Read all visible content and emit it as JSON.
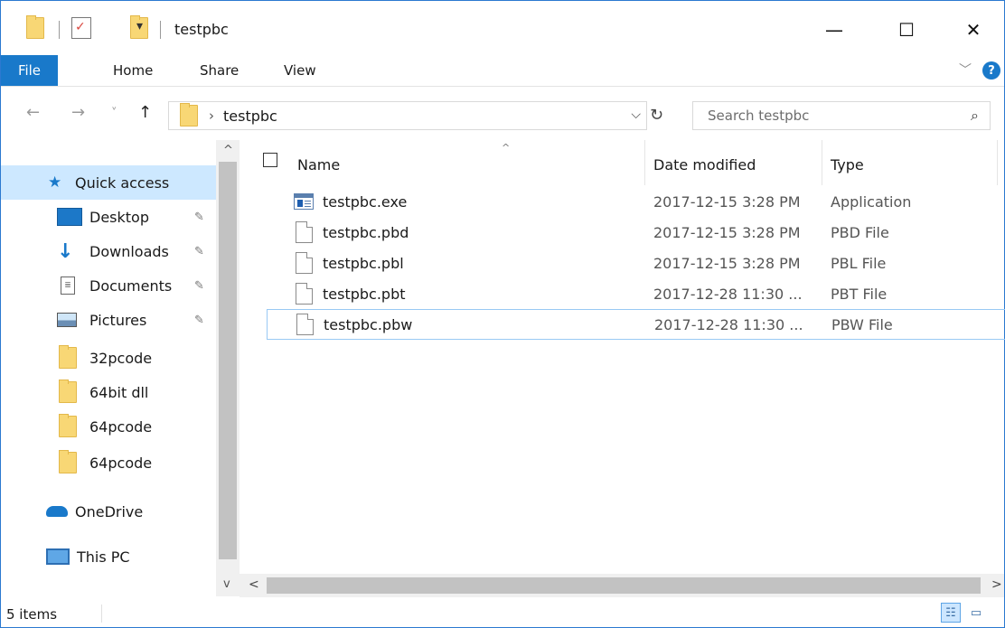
{
  "window": {
    "title": "testpbc",
    "controls": {
      "minimize": "—",
      "maximize": "☐",
      "close": "✕"
    }
  },
  "ribbon": {
    "tabs": [
      "File",
      "Home",
      "Share",
      "View"
    ],
    "help": "?",
    "collapse": "﹀"
  },
  "navigation": {
    "back": "←",
    "forward": "→",
    "recent": "˅",
    "up": "↑",
    "breadcrumb": [
      "testpbc"
    ],
    "breadcrumb_sep": "›",
    "dropdown": "⌵",
    "refresh": "↻"
  },
  "search": {
    "placeholder": "Search testpbc",
    "icon": "⌕"
  },
  "nav_pane": {
    "items": [
      {
        "label": "Quick access",
        "icon": "star-icon",
        "selected": true
      },
      {
        "label": "Desktop",
        "icon": "desktop-icon",
        "pinned": true
      },
      {
        "label": "Downloads",
        "icon": "download-arrow-icon",
        "pinned": true
      },
      {
        "label": "Documents",
        "icon": "documents-icon",
        "pinned": true
      },
      {
        "label": "Pictures",
        "icon": "pictures-icon",
        "pinned": true
      },
      {
        "label": "32pcode",
        "icon": "folder-icon"
      },
      {
        "label": "64bit dll",
        "icon": "folder-icon"
      },
      {
        "label": "64pcode",
        "icon": "folder-icon"
      },
      {
        "label": "64pcode",
        "icon": "folder-icon"
      },
      {
        "label": "OneDrive",
        "icon": "cloud-icon"
      },
      {
        "label": "This PC",
        "icon": "computer-icon"
      }
    ],
    "pin_glyph": "📌"
  },
  "file_list": {
    "columns": [
      "Name",
      "Date modified",
      "Type"
    ],
    "sort_indicator": "^",
    "rows": [
      {
        "name": "testpbc.exe",
        "date": "2017-12-15 3:28 PM",
        "type": "Application",
        "icon": "application-icon"
      },
      {
        "name": "testpbc.pbd",
        "date": "2017-12-15 3:28 PM",
        "type": "PBD File",
        "icon": "file-icon"
      },
      {
        "name": "testpbc.pbl",
        "date": "2017-12-15 3:28 PM",
        "type": "PBL File",
        "icon": "file-icon"
      },
      {
        "name": "testpbc.pbt",
        "date": "2017-12-28 11:30 ...",
        "type": "PBT File",
        "icon": "file-icon"
      },
      {
        "name": "testpbc.pbw",
        "date": "2017-12-28 11:30 ...",
        "type": "PBW File",
        "icon": "file-icon",
        "focused": true
      }
    ]
  },
  "status_bar": {
    "item_count": "5 items"
  },
  "scroll": {
    "up": "^",
    "down": "v",
    "left": "<",
    "right": ">"
  },
  "colors": {
    "accent": "#1979ca",
    "selection": "#cde8ff",
    "folder": "#f8d775"
  }
}
